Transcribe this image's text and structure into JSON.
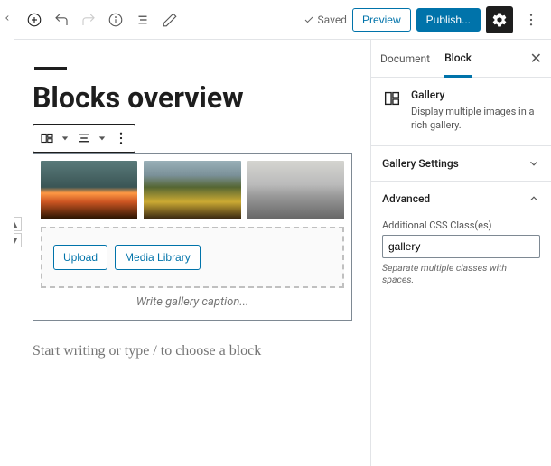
{
  "topbar": {
    "saved_label": "Saved",
    "preview_label": "Preview",
    "publish_label": "Publish..."
  },
  "editor": {
    "title": "Blocks overview",
    "upload_label": "Upload",
    "media_library_label": "Media Library",
    "caption_placeholder": "Write gallery caption...",
    "body_placeholder": "Start writing or type / to choose a block"
  },
  "sidebar": {
    "tabs": {
      "document": "Document",
      "block": "Block"
    },
    "block_card": {
      "name": "Gallery",
      "description": "Display multiple images in a rich gallery."
    },
    "panels": {
      "settings": "Gallery Settings",
      "advanced": "Advanced"
    },
    "advanced": {
      "label": "Additional CSS Class(es)",
      "value": "gallery",
      "hint": "Separate multiple classes with spaces."
    }
  },
  "icons": {
    "add": "add-icon",
    "align": "align-icon",
    "more": "more-icon",
    "gallery": "gallery-icon",
    "gear": "gear-icon"
  }
}
